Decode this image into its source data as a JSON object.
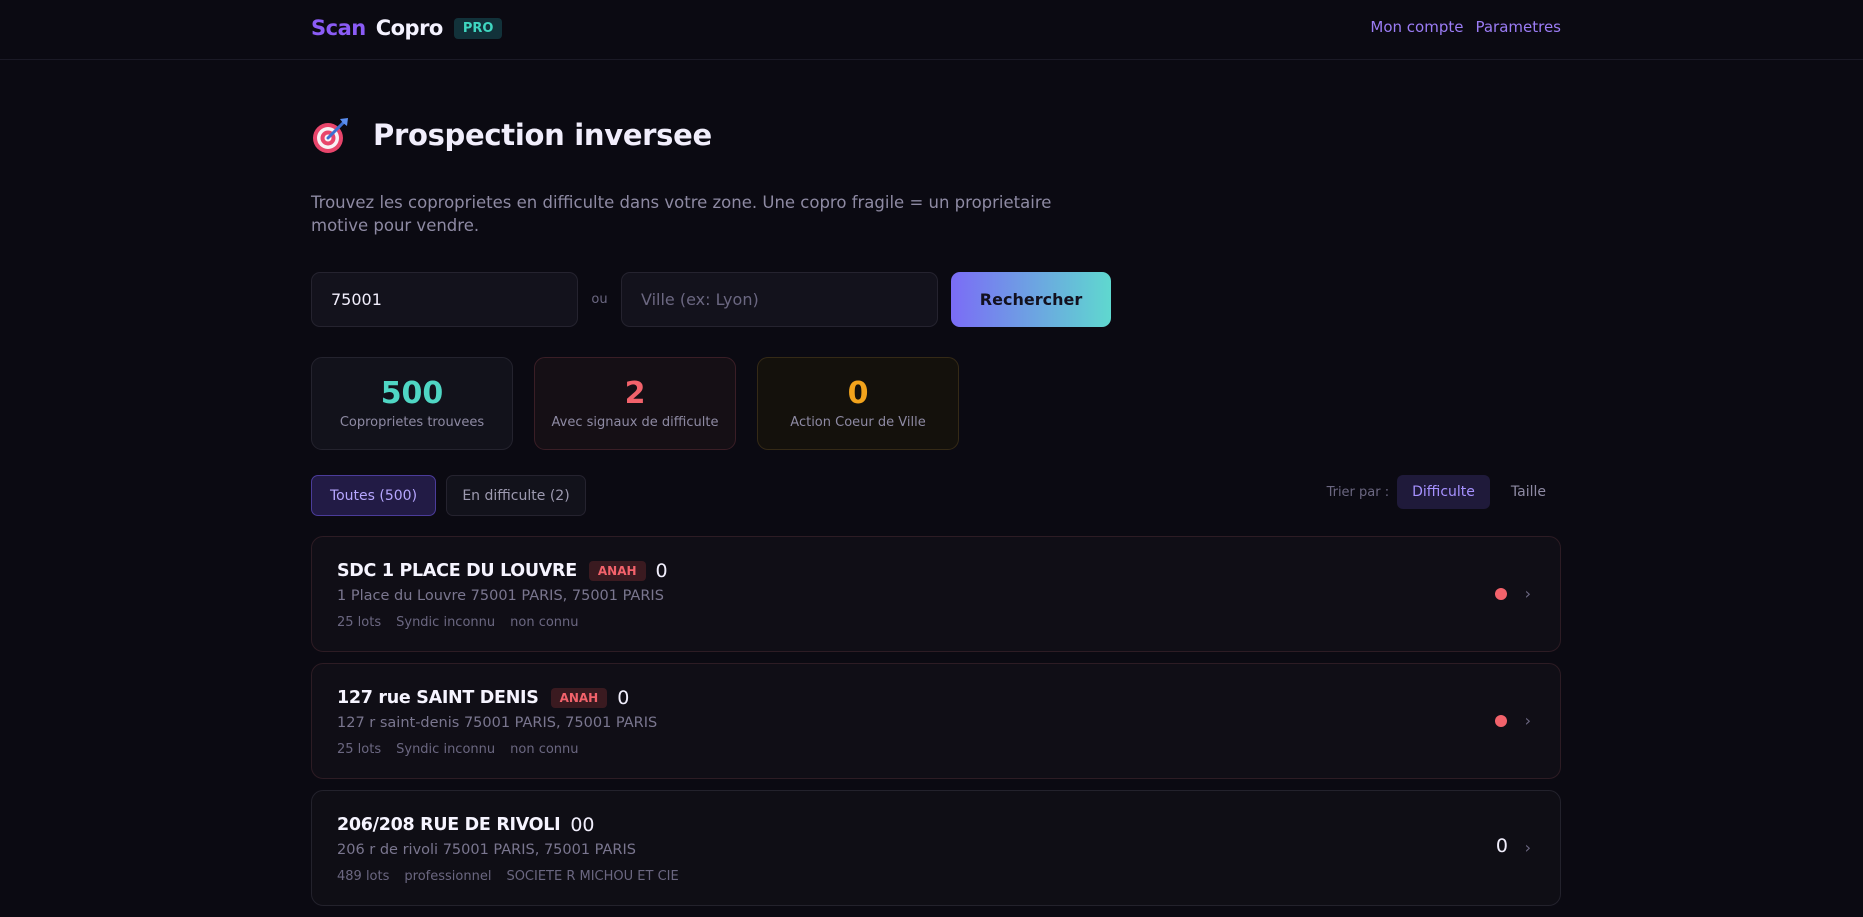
{
  "header": {
    "brand_scan": "Scan",
    "brand_copro": "Copro",
    "pro_badge": "PRO",
    "nav": [
      "Mon compte",
      "Parametres"
    ]
  },
  "page": {
    "title": "Prospection inversee",
    "title_icon": "target-icon",
    "subtitle": "Trouvez les coproprietes en difficulte dans votre zone. Une copro fragile = un proprietaire motive pour vendre."
  },
  "search": {
    "postal_value": "75001",
    "or_label": "ou",
    "city_placeholder": "Ville (ex: Lyon)",
    "button_label": "Rechercher"
  },
  "stats": [
    {
      "value": "500",
      "label": "Coproprietes trouvees"
    },
    {
      "value": "2",
      "label": "Avec signaux de difficulte"
    },
    {
      "value": "0",
      "label": "Action Coeur de Ville"
    }
  ],
  "filters": {
    "tabs": [
      "Toutes (500)",
      "En difficulte (2)"
    ],
    "sort_label": "Trier par :",
    "sort_options": [
      "Difficulte",
      "Taille"
    ]
  },
  "results": [
    {
      "name": "SDC 1 PLACE DU LOUVRE",
      "badge": "ANAH",
      "extra": "0",
      "address": "1 Place du Louvre 75001 PARIS, 75001 PARIS",
      "meta": [
        "25 lots",
        "Syndic inconnu",
        "non connu"
      ]
    },
    {
      "name": "127 rue SAINT DENIS",
      "badge": "ANAH",
      "extra": "0",
      "address": "127 r saint-denis 75001 PARIS, 75001 PARIS",
      "meta": [
        "25 lots",
        "Syndic inconnu",
        "non connu"
      ]
    },
    {
      "name": "206/208 RUE DE RIVOLI",
      "extra": "00",
      "score": "0",
      "address": "206 r de rivoli 75001 PARIS, 75001 PARIS",
      "meta": [
        "489 lots",
        "professionnel",
        "SOCIETE R MICHOU ET CIE"
      ]
    }
  ],
  "colors": {
    "accent": "#8b5cf6",
    "teal": "#4fd6c4",
    "danger": "#f2626b",
    "warning": "#f2a31c",
    "background": "#0b0a12"
  }
}
